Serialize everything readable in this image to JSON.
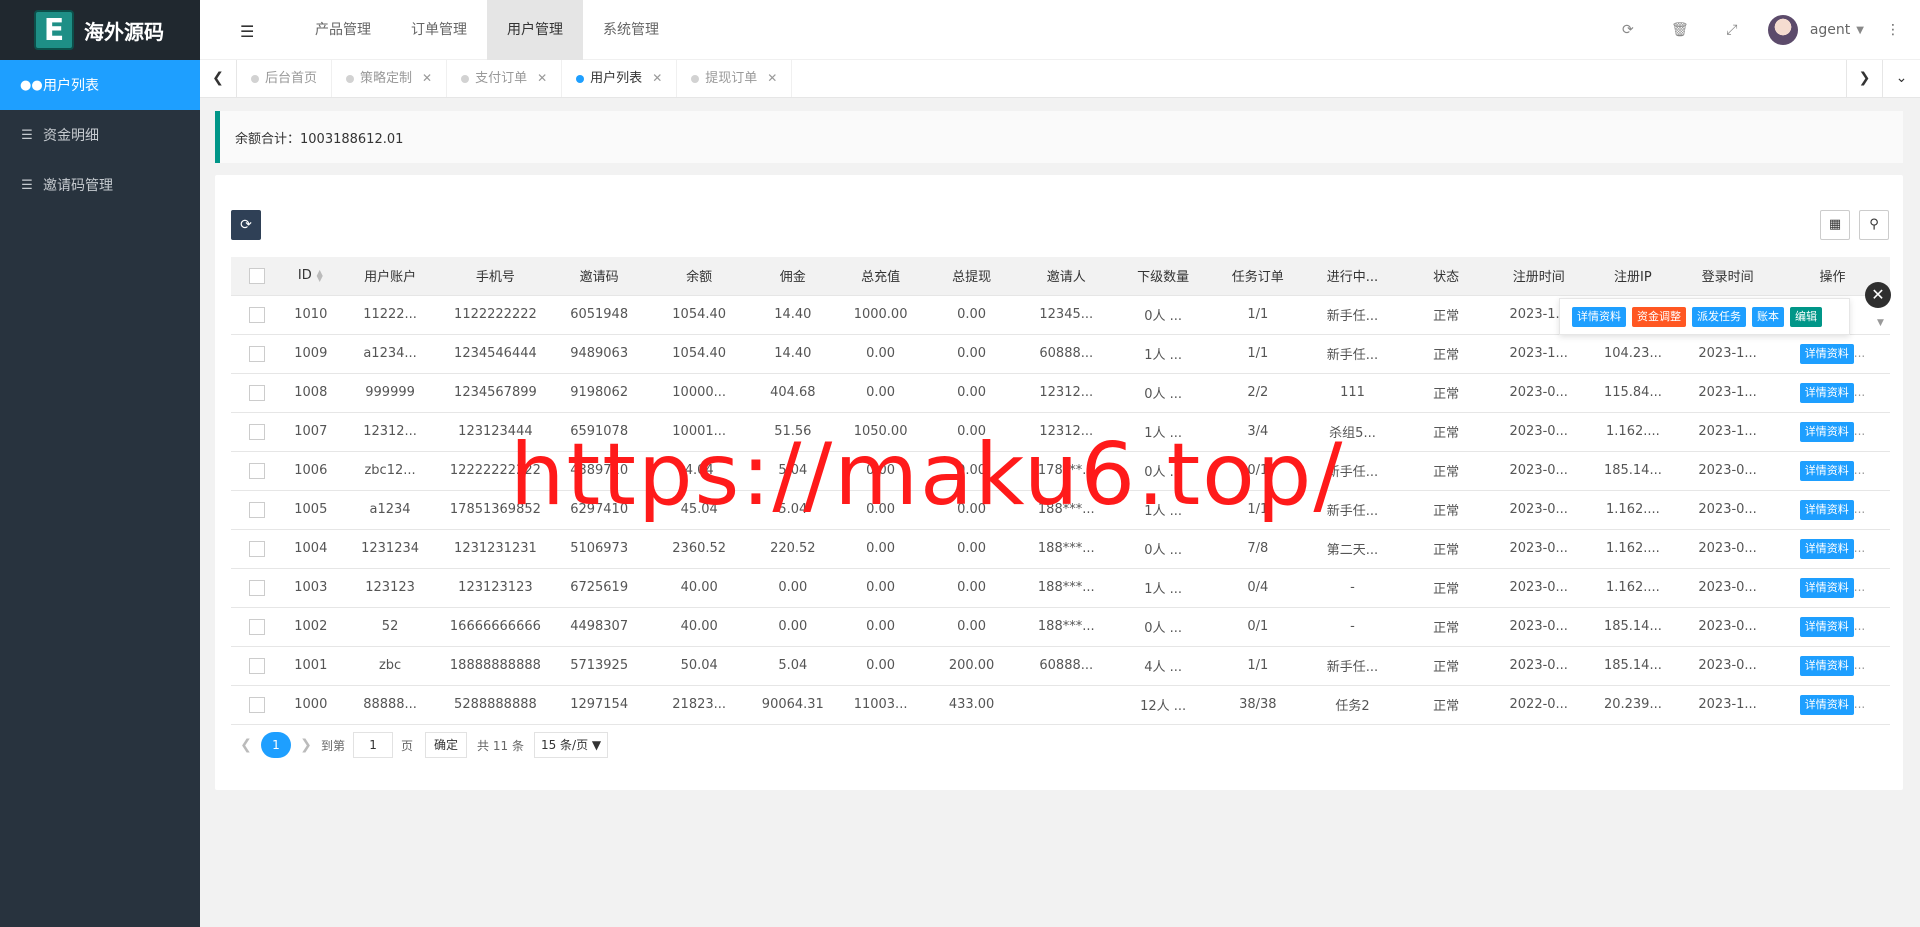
{
  "app": {
    "logo_letter": "E",
    "logo_text": "海外源码"
  },
  "sidebar": {
    "items": [
      {
        "label": "用户列表",
        "icon": "users-icon",
        "active": true
      },
      {
        "label": "资金明细",
        "icon": "list-icon",
        "active": false
      },
      {
        "label": "邀请码管理",
        "icon": "list-icon",
        "active": false
      }
    ]
  },
  "header": {
    "nav": [
      "产品管理",
      "订单管理",
      "用户管理",
      "系统管理"
    ],
    "active_nav": "用户管理",
    "user_name": "agent"
  },
  "tabs": {
    "items": [
      {
        "label": "后台首页",
        "closable": false,
        "active": false
      },
      {
        "label": "策略定制",
        "closable": true,
        "active": false
      },
      {
        "label": "支付订单",
        "closable": true,
        "active": false
      },
      {
        "label": "用户列表",
        "closable": true,
        "active": true
      },
      {
        "label": "提现订单",
        "closable": true,
        "active": false
      }
    ]
  },
  "summary": {
    "text": "余额合计：1003188612.01"
  },
  "table": {
    "columns": [
      "ID",
      "用户账户",
      "手机号",
      "邀请码",
      "余额",
      "佣金",
      "总充值",
      "总提现",
      "邀请人",
      "下级数量",
      "任务订单",
      "进行中...",
      "状态",
      "注册时间",
      "注册IP",
      "登录时间",
      "操作"
    ],
    "rows": [
      [
        "1010",
        "11222...",
        "1122222222",
        "6051948",
        "1054.40",
        "14.40",
        "1000.00",
        "0.00",
        "12345...",
        "0人 ...",
        "1/1",
        "新手任...",
        "正常",
        "2023-1...",
        "",
        "",
        ""
      ],
      [
        "1009",
        "a1234...",
        "1234546444",
        "9489063",
        "1054.40",
        "14.40",
        "0.00",
        "0.00",
        "60888...",
        "1人 ...",
        "1/1",
        "新手任...",
        "正常",
        "2023-1...",
        "104.23...",
        "2023-1...",
        "详情资料"
      ],
      [
        "1008",
        "999999",
        "1234567899",
        "9198062",
        "10000...",
        "404.68",
        "0.00",
        "0.00",
        "12312...",
        "0人 ...",
        "2/2",
        "111",
        "正常",
        "2023-0...",
        "115.84...",
        "2023-1...",
        "详情资料"
      ],
      [
        "1007",
        "12312...",
        "123123444",
        "6591078",
        "10001...",
        "51.56",
        "1050.00",
        "0.00",
        "12312...",
        "1人 ...",
        "3/4",
        "杀组5...",
        "正常",
        "2023-0...",
        "1.162....",
        "2023-1...",
        "详情资料"
      ],
      [
        "1006",
        "zbc12...",
        "12222222222",
        "4389710",
        "4.04",
        "5.04",
        "0.00",
        "0.00",
        "178***...",
        "0人 ...",
        "0/1",
        "新手任...",
        "正常",
        "2023-0...",
        "185.14...",
        "2023-0...",
        "详情资料"
      ],
      [
        "1005",
        "a1234",
        "17851369852",
        "6297410",
        "45.04",
        "5.04",
        "0.00",
        "0.00",
        "188***...",
        "1人 ...",
        "1/1",
        "新手任...",
        "正常",
        "2023-0...",
        "1.162....",
        "2023-0...",
        "详情资料"
      ],
      [
        "1004",
        "1231234",
        "1231231231",
        "5106973",
        "2360.52",
        "220.52",
        "0.00",
        "0.00",
        "188***...",
        "0人 ...",
        "7/8",
        "第二天...",
        "正常",
        "2023-0...",
        "1.162....",
        "2023-0...",
        "详情资料"
      ],
      [
        "1003",
        "123123",
        "123123123",
        "6725619",
        "40.00",
        "0.00",
        "0.00",
        "0.00",
        "188***...",
        "1人 ...",
        "0/4",
        "-",
        "正常",
        "2023-0...",
        "1.162....",
        "2023-0...",
        "详情资料"
      ],
      [
        "1002",
        "52",
        "16666666666",
        "4498307",
        "40.00",
        "0.00",
        "0.00",
        "0.00",
        "188***...",
        "0人 ...",
        "0/1",
        "-",
        "正常",
        "2023-0...",
        "185.14...",
        "2023-0...",
        "详情资料"
      ],
      [
        "1001",
        "zbc",
        "18888888888",
        "5713925",
        "50.04",
        "5.04",
        "0.00",
        "200.00",
        "60888...",
        "4人 ...",
        "1/1",
        "新手任...",
        "正常",
        "2023-0...",
        "185.14...",
        "2023-0...",
        "详情资料"
      ],
      [
        "1000",
        "88888...",
        "5288888888",
        "1297154",
        "21823...",
        "90064.31",
        "11003...",
        "433.00",
        "",
        "12人 ...",
        "38/38",
        "任务2",
        "正常",
        "2022-0...",
        "20.239...",
        "2023-1...",
        "详情资料"
      ]
    ]
  },
  "popup": {
    "buttons": [
      {
        "label": "详情资料",
        "color": "#1e9fff"
      },
      {
        "label": "资金调整",
        "color": "#ff5722"
      },
      {
        "label": "派发任务",
        "color": "#1e9fff"
      },
      {
        "label": "账本",
        "color": "#1e9fff"
      },
      {
        "label": "编辑",
        "color": "#009688"
      }
    ]
  },
  "pagination": {
    "current": "1",
    "goto_label": "到第",
    "page_input": "1",
    "page_label": "页",
    "confirm": "确定",
    "total": "共 11 条",
    "page_size": "15 条/页"
  },
  "watermark": "https://maku6.top/",
  "colors": {
    "sidebar_bg": "#28333e",
    "accent": "#1e9fff",
    "danger": "#ff5722",
    "teal": "#009688"
  }
}
